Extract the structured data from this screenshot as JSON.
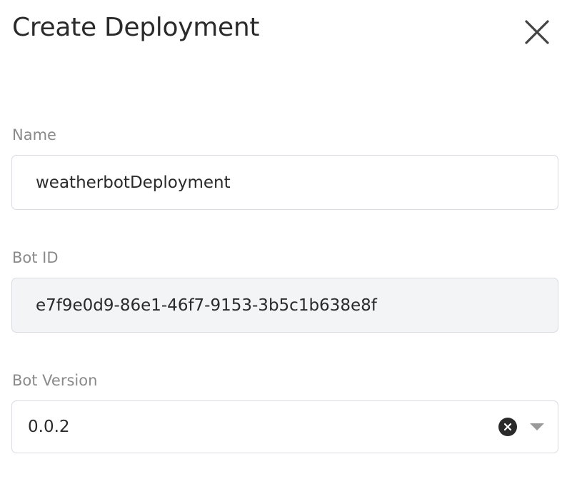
{
  "dialog": {
    "title": "Create Deployment",
    "close_icon": "close-icon"
  },
  "fields": {
    "name": {
      "label": "Name",
      "value": "weatherbotDeployment"
    },
    "bot_id": {
      "label": "Bot ID",
      "value": "e7f9e0d9-86e1-46f7-9153-3b5c1b638e8f"
    },
    "bot_version": {
      "label": "Bot Version",
      "selected": "0.0.2",
      "clear_icon": "clear-icon",
      "dropdown_icon": "chevron-down-icon"
    }
  },
  "colors": {
    "label": "#8a8a8a",
    "text": "#2a2a2a",
    "border": "#d9dbe0",
    "readonly_bg": "#f3f4f6"
  }
}
